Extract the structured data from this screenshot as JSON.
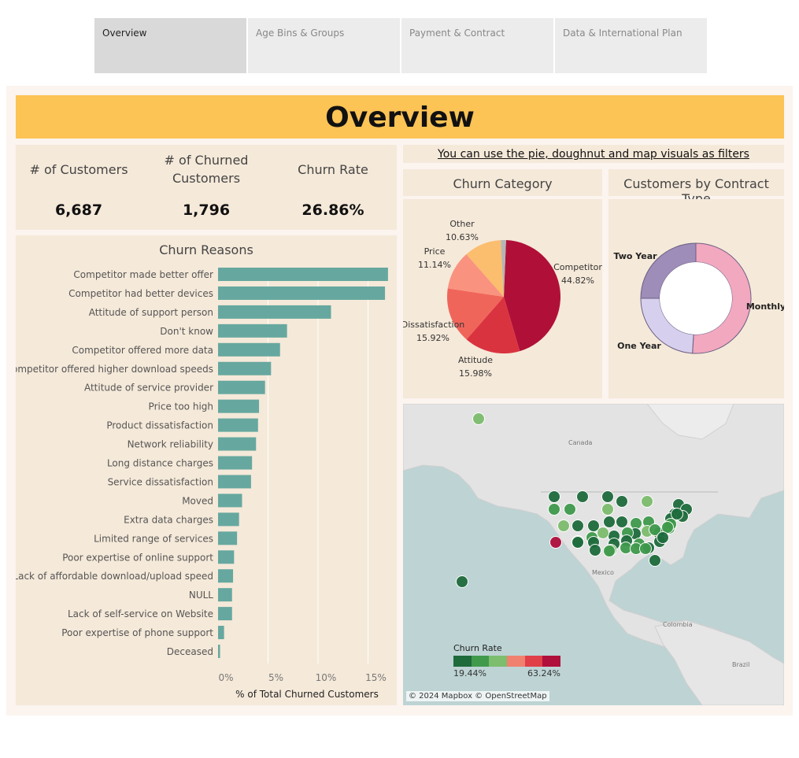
{
  "tabs": [
    "Overview",
    "Age Bins & Groups",
    "Payment & Contract",
    "Data & International Plan"
  ],
  "header": {
    "title": "Overview"
  },
  "filter_note": "You can use the pie, doughnut and map visuals as filters",
  "kpis": {
    "customers_label": "# of Customers",
    "customers_value": "6,687",
    "churned_label_1": "# of Churned",
    "churned_label_2": "Customers",
    "churned_value": "1,796",
    "rate_label": "Churn Rate",
    "rate_value": "26.86%"
  },
  "churn_reasons": {
    "title": "Churn Reasons",
    "xlabel": "% of Total Churned Customers",
    "ticks": [
      "0%",
      "5%",
      "10%",
      "15%"
    ],
    "bar_color": "#66a89f"
  },
  "churn_category": {
    "title": "Churn Category",
    "slices": [
      {
        "name": "Competitor",
        "pct": "44.82%",
        "color": "#b01038"
      },
      {
        "name": "Attitude",
        "pct": "15.98%",
        "color": "#da3340"
      },
      {
        "name": "Dissatisfaction",
        "pct": "15.92%",
        "color": "#f0655a"
      },
      {
        "name": "Price",
        "pct": "11.14%",
        "color": "#f99380"
      },
      {
        "name": "Other",
        "pct": "10.63%",
        "color": "#fbbd6e"
      }
    ]
  },
  "contract": {
    "title": "Customers by Contract Type",
    "labels": {
      "monthly": "Monthly",
      "one_year": "One Year",
      "two_year": "Two Year"
    },
    "colors": {
      "monthly": "#f2a8bf",
      "one_year": "#d6d0ee",
      "two_year": "#9d8db8"
    }
  },
  "map": {
    "labels": {
      "canada": "Canada",
      "mexico": "Mexico",
      "colombia": "Colombia",
      "brazil": "Brazil"
    },
    "legend_title": "Churn Rate",
    "legend_min": "19.44%",
    "legend_max": "63.24%",
    "attribution": "© 2024 Mapbox © OpenStreetMap",
    "legend_colors": [
      "#1e6b3c",
      "#3f9a4c",
      "#7cbd6e",
      "#f08070",
      "#e04048",
      "#b0103c"
    ]
  },
  "chart_data": [
    {
      "type": "bar",
      "title": "Churn Reasons",
      "xlabel": "% of Total Churned Customers",
      "xlim": [
        0,
        17.5
      ],
      "categories": [
        "Competitor made better offer",
        "Competitor had better devices",
        "Attitude of support person",
        "Don't know",
        "Competitor offered more data",
        "Competitor offered higher download speeds",
        "Attitude of service provider",
        "Price too high",
        "Product dissatisfaction",
        "Network reliability",
        "Long distance charges",
        "Service dissatisfaction",
        "Moved",
        "Extra data charges",
        "Limited range of services",
        "Poor expertise of online support",
        "Lack of affordable download/upload speed",
        "NULL",
        "Lack of self-service on Website",
        "Poor expertise of phone support",
        "Deceased"
      ],
      "values": [
        17.0,
        16.7,
        11.3,
        6.9,
        6.2,
        5.3,
        4.7,
        4.1,
        4.0,
        3.8,
        3.4,
        3.3,
        2.4,
        2.1,
        1.9,
        1.6,
        1.5,
        1.4,
        1.4,
        0.6,
        0.2
      ]
    },
    {
      "type": "pie",
      "title": "Churn Category",
      "categories": [
        "Competitor",
        "Attitude",
        "Dissatisfaction",
        "Price",
        "Other"
      ],
      "values": [
        44.82,
        15.98,
        15.92,
        11.14,
        10.63
      ]
    },
    {
      "type": "pie",
      "title": "Customers by Contract Type",
      "categories": [
        "Monthly",
        "One Year",
        "Two Year"
      ],
      "values": [
        51,
        24,
        25
      ]
    }
  ]
}
